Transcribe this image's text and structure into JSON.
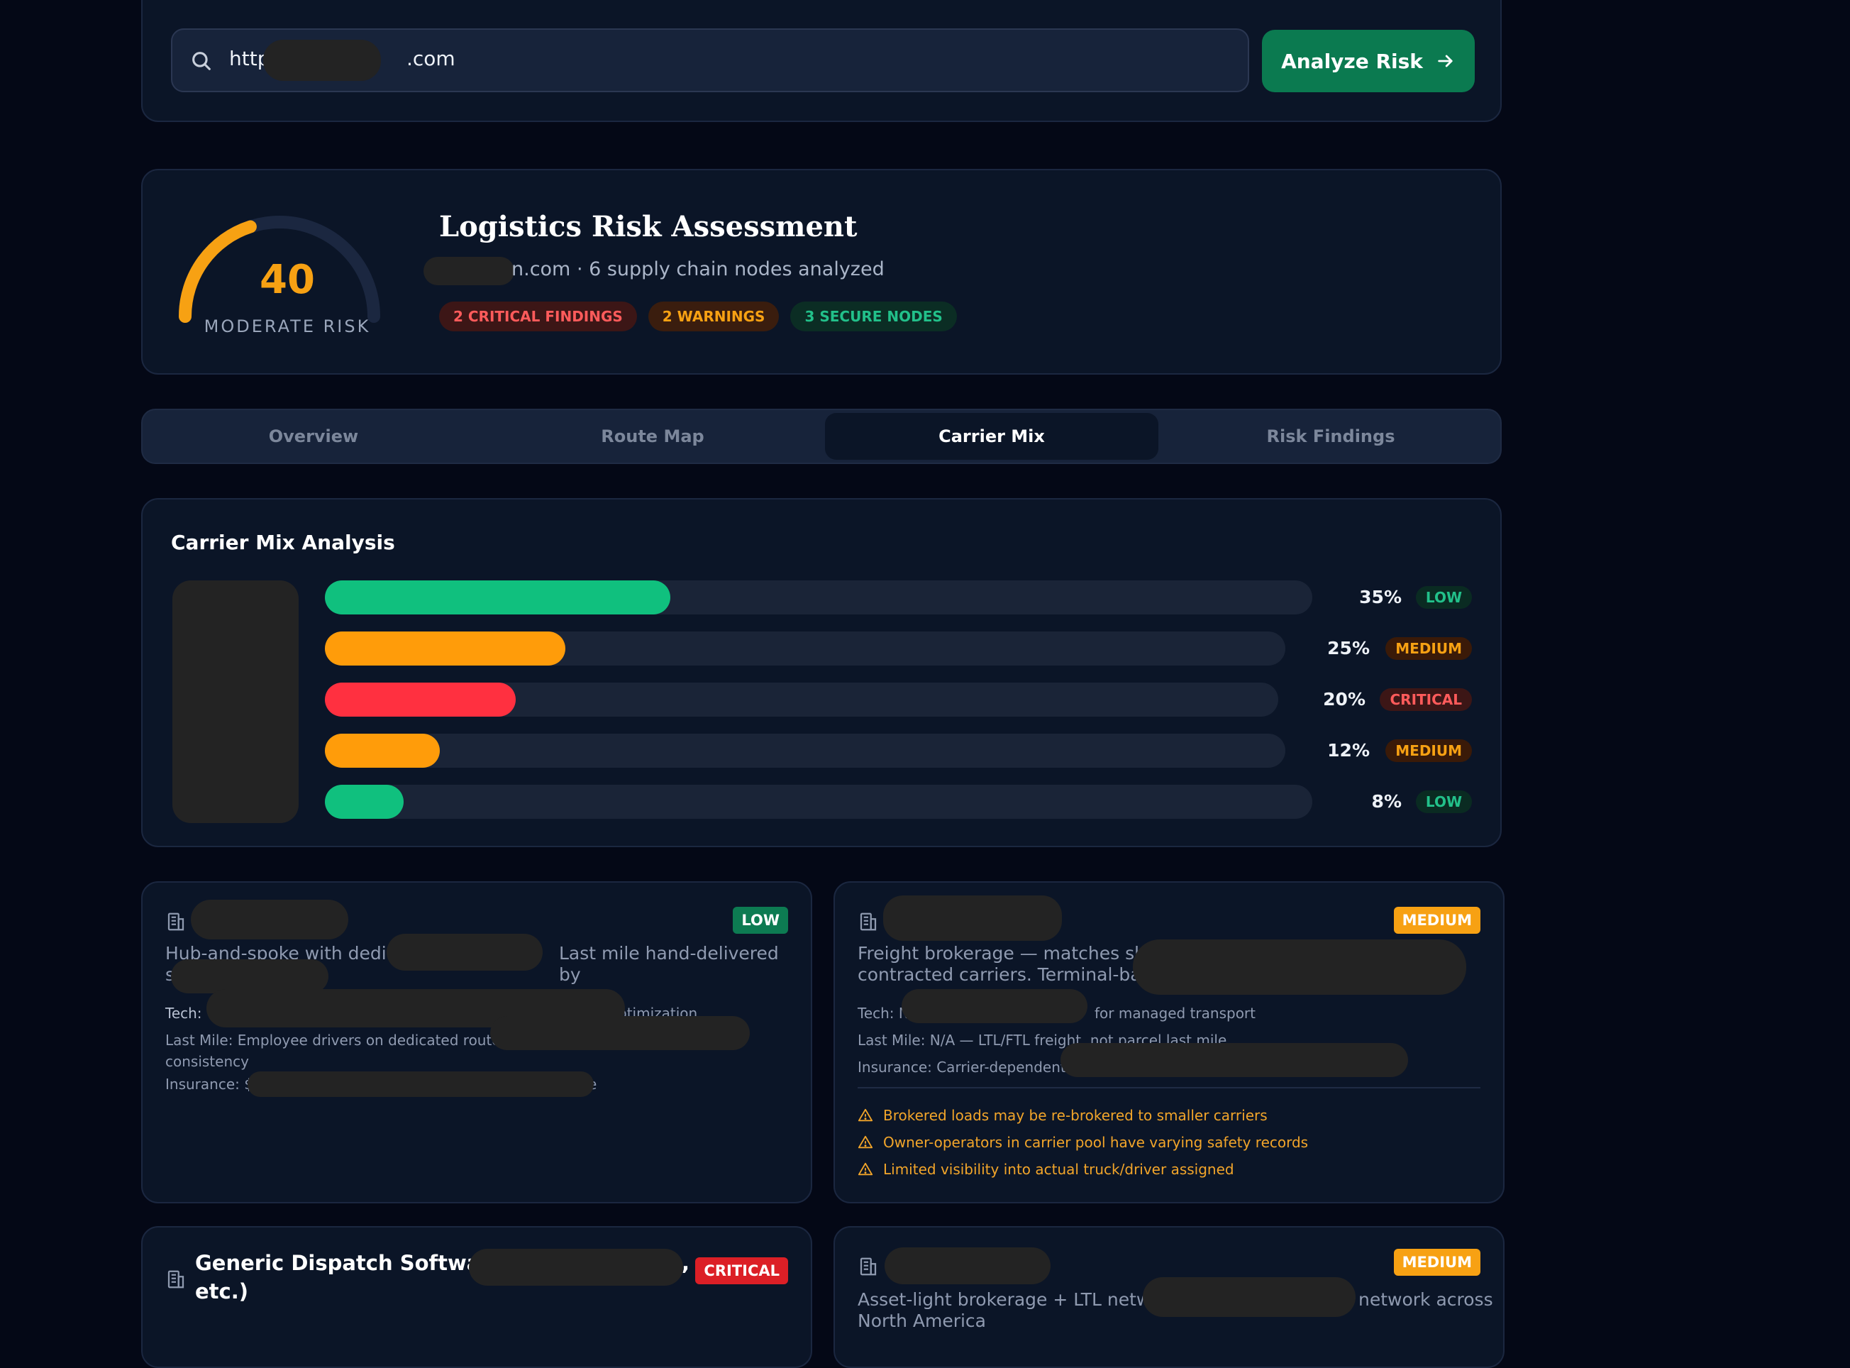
{
  "search": {
    "url_prefix": "http",
    "url_suffix": ".com",
    "button_label": "Analyze Risk",
    "button_icon": "arrow-right-icon"
  },
  "assessment": {
    "score": "40",
    "risk_label": "MODERATE RISK",
    "score_fraction": 0.4,
    "title": "Logistics Risk Assessment",
    "subtitle": "n.com · 6 supply chain nodes analyzed",
    "badges": {
      "critical": "2 CRITICAL FINDINGS",
      "warnings": "2 WARNINGS",
      "secure": "3 SECURE NODES"
    },
    "colors": {
      "gauge": "#f7a113",
      "track": "#1b2740"
    }
  },
  "tabs": [
    {
      "label": "Overview",
      "active": false
    },
    {
      "label": "Route Map",
      "active": false
    },
    {
      "label": "Carrier Mix",
      "active": true
    },
    {
      "label": "Risk Findings",
      "active": false
    }
  ],
  "carrier_mix": {
    "title": "Carrier Mix Analysis",
    "rows": [
      {
        "percent": 35,
        "percent_label": "35%",
        "risk": "LOW",
        "color": "#10c07e"
      },
      {
        "percent": 25,
        "percent_label": "25%",
        "risk": "MEDIUM",
        "color": "#ff9c0a"
      },
      {
        "percent": 20,
        "percent_label": "20%",
        "risk": "CRITICAL",
        "color": "#ff3040"
      },
      {
        "percent": 12,
        "percent_label": "12%",
        "risk": "MEDIUM",
        "color": "#ff9c0a"
      },
      {
        "percent": 8,
        "percent_label": "8%",
        "risk": "LOW",
        "color": "#10c07e"
      }
    ]
  },
  "cards": [
    {
      "tag": "LOW",
      "desc_1": "Hub-and-spoke with dedicat",
      "desc_2": "Last mile hand-delivered by",
      "desc_3": "s",
      "tech_label": "Tech:",
      "tech_tail": "ptimization",
      "last_mile": "Last Mile: Employee drivers on dedicated routes –",
      "last_mile_2": "consistency",
      "insurance": "Insurance: $",
      "insurance_tail": "e"
    },
    {
      "tag": "MEDIUM",
      "desc_1": "Freight brokerage — matches shipp",
      "desc_2": "contracted carriers. Terminal-based",
      "tech_label": "Tech: N",
      "tech_tail": "for managed transport",
      "last_mile": "Last Mile: N/A — LTL/FTL freight, not parcel last mile",
      "insurance": "Insurance: Carrier-dependent -",
      "warnings": [
        "Brokered loads may be re-brokered to smaller carriers",
        "Owner-operators in carrier pool have varying safety records",
        "Limited visibility into actual truck/driver assigned"
      ]
    },
    {
      "tag": "CRITICAL",
      "title_1": "Generic Dispatch Software (",
      "title_comma": ",",
      "title_2": "etc.)"
    },
    {
      "tag": "MEDIUM",
      "desc_1": "Asset-light brokerage + LTL network",
      "desc_tail": "network across",
      "desc_2": "North America"
    }
  ]
}
